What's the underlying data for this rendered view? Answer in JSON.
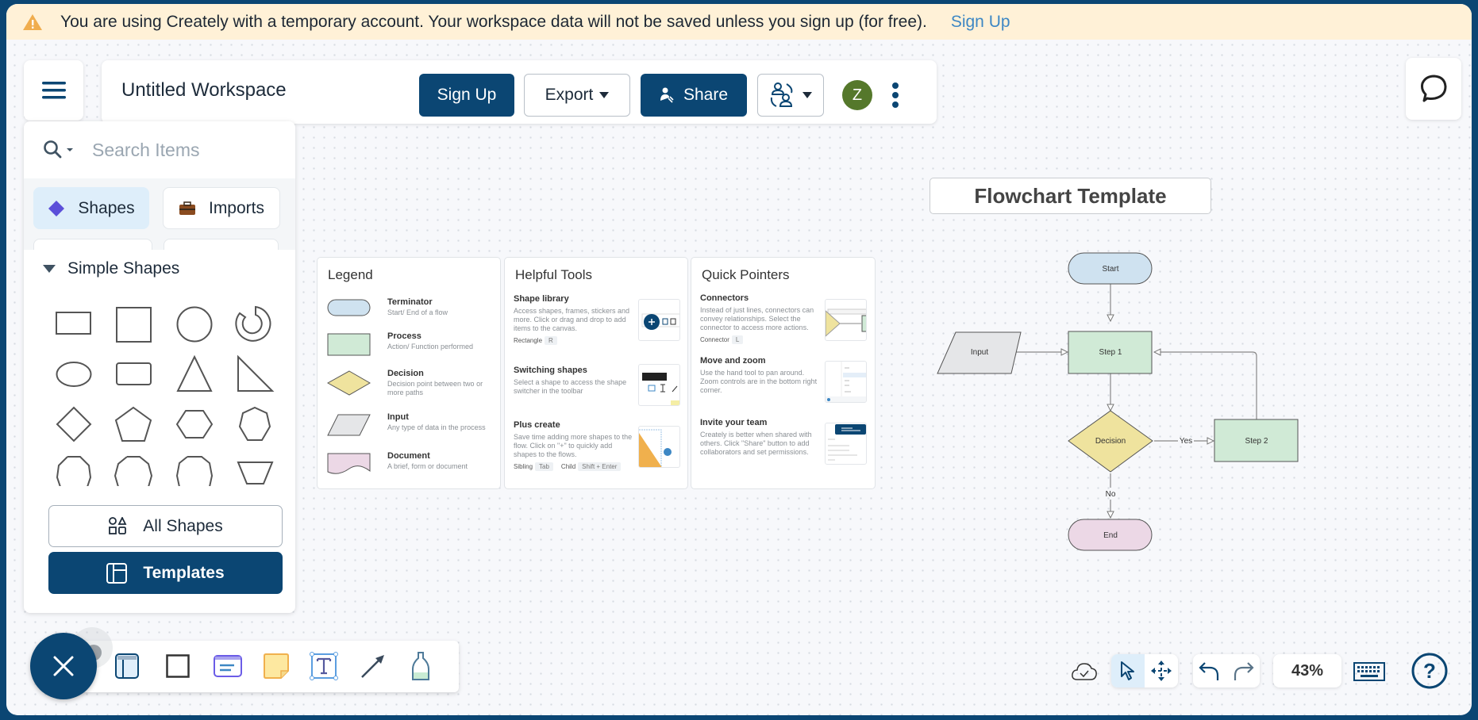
{
  "banner": {
    "message": "You are using Creately with a temporary account. Your workspace data will not be saved unless you sign up (for free).",
    "link": "Sign Up",
    "icon": "warning-icon"
  },
  "header": {
    "title": "Untitled Workspace",
    "signup_label": "Sign Up",
    "export_label": "Export",
    "share_label": "Share",
    "avatar_initial": "Z"
  },
  "panel": {
    "search_placeholder": "Search Items",
    "tabs": [
      {
        "label": "Shapes",
        "icon": "diamond-icon",
        "active": true
      },
      {
        "label": "Imports",
        "icon": "briefcase-icon",
        "active": false
      }
    ],
    "section_title": "Simple Shapes",
    "shapes": [
      "rectangle",
      "square",
      "circle",
      "donut",
      "ellipse",
      "rounded-rectangle",
      "triangle",
      "right-triangle",
      "diamond",
      "pentagon",
      "hexagon",
      "heptagon",
      "octagon",
      "nonagon",
      "decagon",
      "trapezoid"
    ],
    "all_shapes_label": "All Shapes",
    "templates_label": "Templates"
  },
  "legend_card": {
    "title": "Legend",
    "items": [
      {
        "title": "Terminator",
        "desc": "Start/ End of a flow",
        "color": "#cfe2f0"
      },
      {
        "title": "Process",
        "desc": "Action/ Function performed",
        "color": "#d0ead6"
      },
      {
        "title": "Decision",
        "desc": "Decision point between two or more paths",
        "color": "#efe39e"
      },
      {
        "title": "Input",
        "desc": "Any type of data in the process",
        "color": "#e5e6e8"
      },
      {
        "title": "Document",
        "desc": "A brief, form or document",
        "color": "#ecd8e6"
      }
    ]
  },
  "tools_card": {
    "title": "Helpful Tools",
    "items": [
      {
        "title": "Shape library",
        "desc": "Access shapes, frames, stickers and more. Click or drag and drop to add items to the canvas.",
        "keys": [
          {
            "label": "Rectangle",
            "key": "R"
          }
        ]
      },
      {
        "title": "Switching shapes",
        "desc": "Select a shape to access the shape switcher in the toolbar",
        "keys": []
      },
      {
        "title": "Plus create",
        "desc": "Save time adding more shapes to the flow. Click on \"+\" to quickly add shapes to the flows.",
        "keys": [
          {
            "label": "Sibling",
            "key": "Tab"
          },
          {
            "label": "Child",
            "key": "Shift + Enter"
          }
        ]
      }
    ]
  },
  "pointers_card": {
    "title": "Quick Pointers",
    "items": [
      {
        "title": "Connectors",
        "desc": "Instead of just lines, connectors can convey relationships. Select the connector to access more actions.",
        "keys": [
          {
            "label": "Connector",
            "key": "L"
          }
        ]
      },
      {
        "title": "Move and zoom",
        "desc": "Use the hand tool to pan around. Zoom controls are in the bottom right corner.",
        "keys": []
      },
      {
        "title": "Invite your team",
        "desc": "Creately is better when shared with others. Click \"Share\" button to add collaborators and set permissions.",
        "keys": []
      }
    ]
  },
  "flowchart": {
    "title": "Flowchart Template",
    "nodes": {
      "start": "Start",
      "input": "Input",
      "step1": "Step 1",
      "decision": "Decision",
      "step2": "Step 2",
      "end": "End"
    },
    "labels": {
      "yes": "Yes",
      "no": "No"
    }
  },
  "bottom_toolbar": {
    "tools": [
      "frame-icon",
      "rectangle-icon",
      "card-icon",
      "sticky-note-icon",
      "text-icon",
      "connector-arrow-icon",
      "highlighter-icon"
    ]
  },
  "bottom_right": {
    "zoom": "43%"
  }
}
